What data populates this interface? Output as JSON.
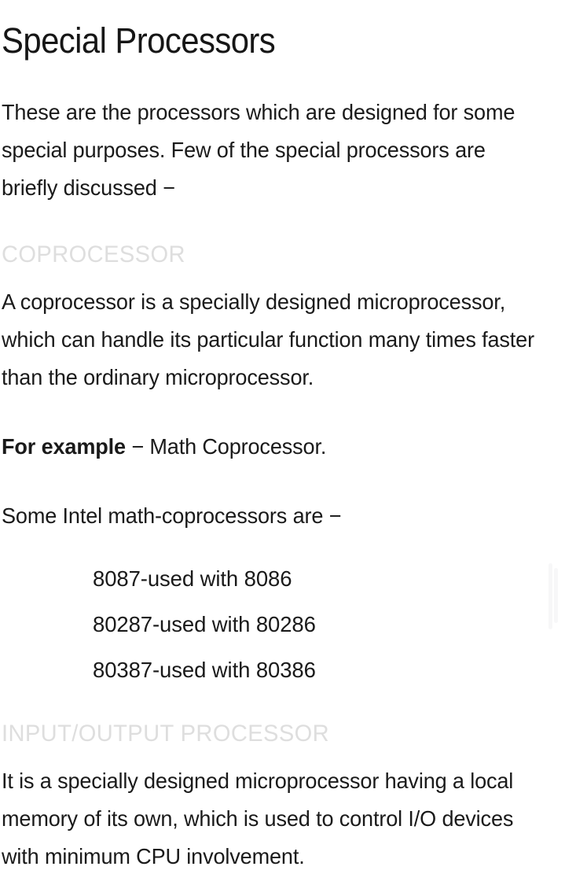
{
  "page": {
    "background_color": "#ffffff",
    "text_color": "#1a1a1a",
    "heading_color": "#dedede",
    "title": "Special Processors"
  },
  "intro": {
    "paragraph": "These are the processors which are designed for some special purposes. Few of the special processors are briefly discussed −"
  },
  "sections": [
    {
      "heading": "COPROCESSOR",
      "paragraph": "A coprocessor is a specially designed microprocessor, which can handle its particular function many times faster than the ordinary microprocessor.",
      "example_label": "For example",
      "example_rest": " − Math Coprocessor.",
      "list_intro": "Some Intel math-coprocessors are −",
      "list_items": [
        "8087-used with 8086",
        "80287-used with 80286",
        "80387-used with 80386"
      ]
    },
    {
      "heading": "INPUT/OUTPUT PROCESSOR",
      "paragraph": "It is a specially designed microprocessor having a local memory of its own, which is used to control I/O devices with minimum CPU involvement."
    }
  ]
}
